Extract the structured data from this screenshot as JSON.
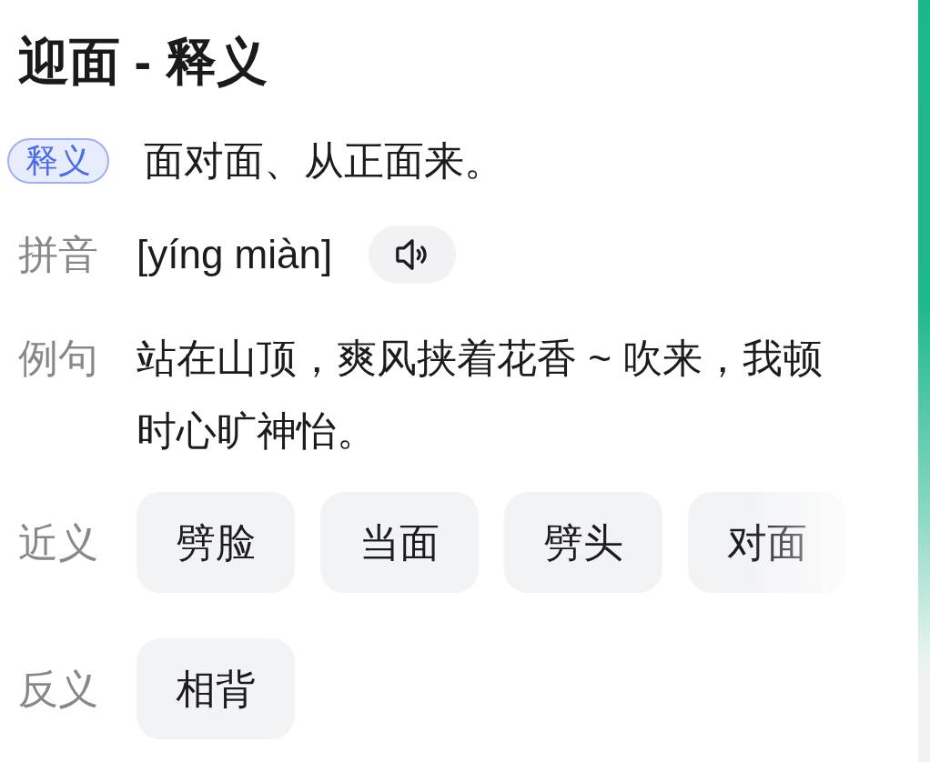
{
  "title": "迎面 - 释义",
  "definition": {
    "badge": "释义",
    "text": "面对面、从正面来。"
  },
  "pinyin": {
    "label": "拼音",
    "text": "[yíng miàn]"
  },
  "example": {
    "label": "例句",
    "text": "站在山顶，爽风挟着花香 ~ 吹来，我顿时心旷神怡。"
  },
  "synonyms": {
    "label": "近义",
    "items": [
      "劈脸",
      "当面",
      "劈头",
      "对面"
    ]
  },
  "antonyms": {
    "label": "反义",
    "items": [
      "相背"
    ]
  }
}
